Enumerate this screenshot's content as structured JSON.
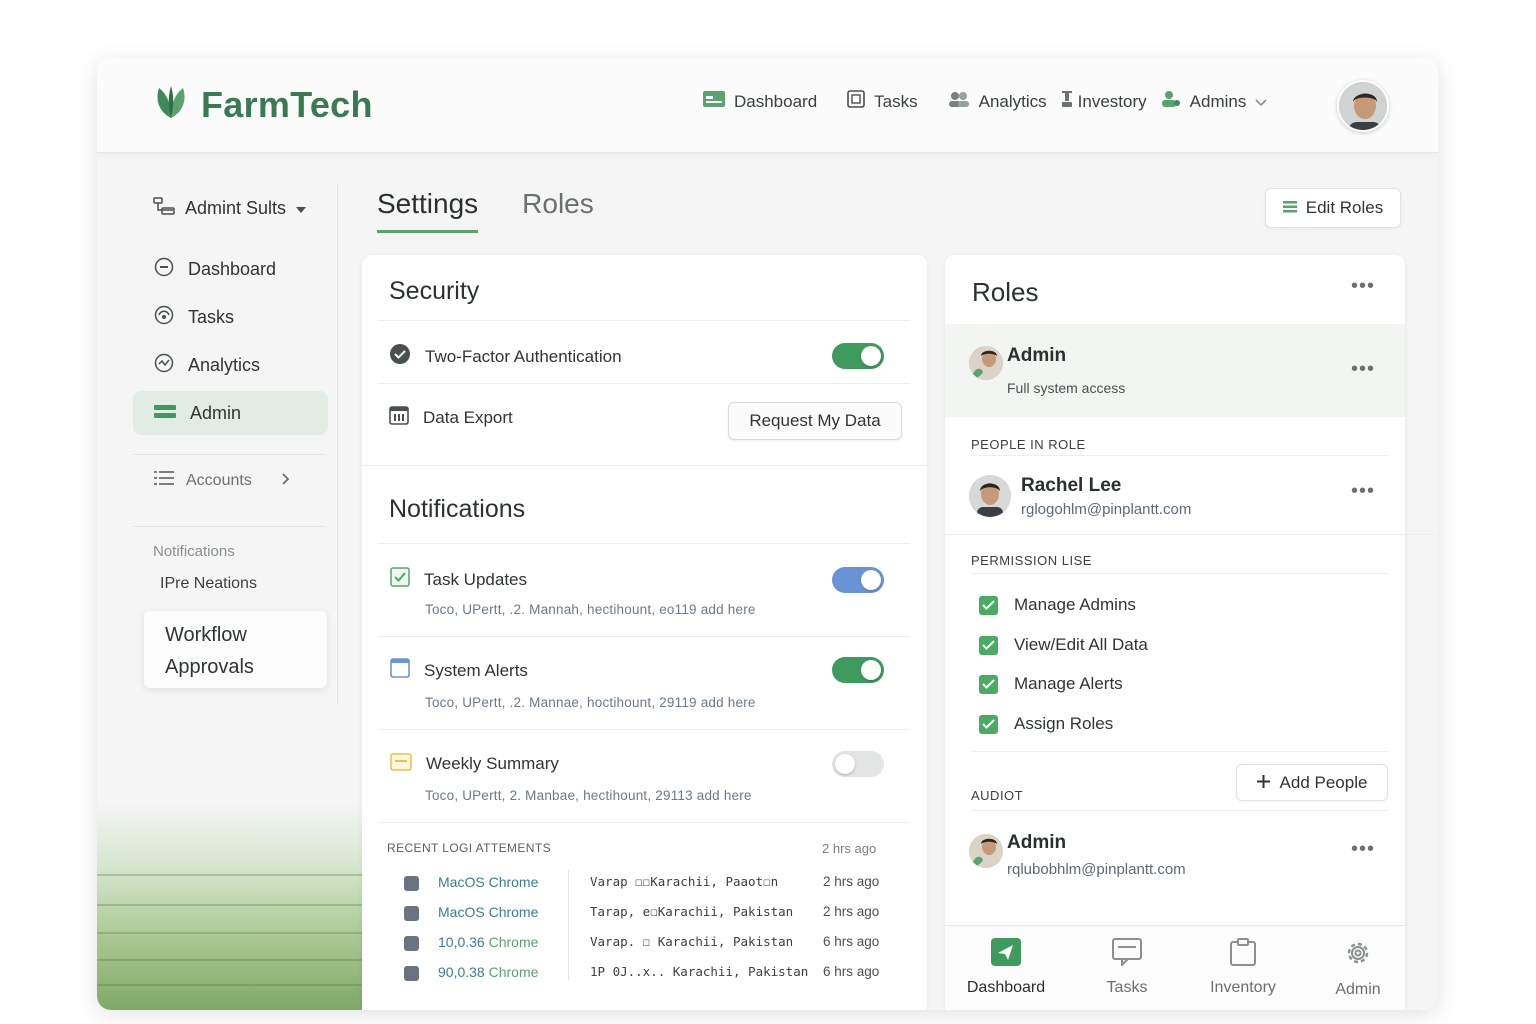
{
  "app": {
    "name": "FarmTech"
  },
  "colors": {
    "brand": "#3a7a52",
    "accent": "#5aa36e",
    "toggle_blue": "#6a93d6"
  },
  "topnav": {
    "items": [
      {
        "label": "Dashboard",
        "icon": "dashboard-icon"
      },
      {
        "label": "Tasks",
        "icon": "tasks-icon"
      },
      {
        "label": "Analytics",
        "icon": "analytics-icon"
      },
      {
        "label": "Investory",
        "icon": "inventory-icon"
      },
      {
        "label": "Admins",
        "icon": "admins-icon"
      }
    ]
  },
  "sidebar": {
    "header": "Admint Sults",
    "items": [
      {
        "label": "Dashboard"
      },
      {
        "label": "Tasks"
      },
      {
        "label": "Analytics"
      },
      {
        "label": "Admin"
      }
    ],
    "accounts": "Accounts",
    "notifications_label": "Notifications",
    "sub_item": "IPre Neations",
    "card_line1": "Workflow",
    "card_line2": "Approvals"
  },
  "tabs": [
    {
      "label": "Settings"
    },
    {
      "label": "Roles"
    }
  ],
  "edit_roles": "Edit Roles",
  "security": {
    "title": "Security",
    "two_factor": "Two-Factor Authentication",
    "data_export": "Data Export",
    "request_button": "Request My Data"
  },
  "notifications": {
    "title": "Notifications",
    "items": [
      {
        "label": "Task Updates",
        "sub": "Toco, UPertt, .2. Mannah, hectihount, eo119 add here",
        "state": "on-blue"
      },
      {
        "label": "System Alerts",
        "sub": "Toco, UPertt, .2. Mannae, hoctihount, 29119 add here",
        "state": "on-green"
      },
      {
        "label": "Weekly Summary",
        "sub": "Toco, UPertt, 2. Manbae, hectihount, 29113 add here",
        "state": "off"
      }
    ]
  },
  "logins": {
    "heading": "RECENT LOGI ATTEMENTS",
    "heading_time": "2 hrs ago",
    "rows": [
      {
        "dev_a": "MacOS",
        "dev_b": "Chrome",
        "loc": "Varap  ☐☐Karachii, Paaot☐n",
        "time": "2 hrs ago"
      },
      {
        "dev_a": "MacOS",
        "dev_b": "Chrome",
        "loc": "Tarap, e☐Karachii, Pakistan",
        "time": "2 hrs ago"
      },
      {
        "dev_a": "10,0.36",
        "dev_b": "Chrome",
        "loc": "Varap. ☐ Karachii, Pakistan",
        "time": "6 hrs ago"
      },
      {
        "dev_a": "90,0.38",
        "dev_b": "Chrome",
        "loc": "1P 0J..x.. Karachii, Pakistan",
        "time": "6 hrs ago"
      }
    ]
  },
  "roles_panel": {
    "title": "Roles",
    "admin": {
      "name": "Admin",
      "sub": "Full system access"
    },
    "people_caption": "PEOPLE IN ROLE",
    "person": {
      "name": "Rachel Lee",
      "email": "rglogohlm@pinplantt.com"
    },
    "permission_caption": "PERMISSION LISE",
    "permissions": [
      "Manage Admins",
      "View/Edit All Data",
      "Manage Alerts",
      "Assign Roles"
    ],
    "add_people": "Add People",
    "audit_caption": "AUDIOT",
    "audit_person": {
      "name": "Admin",
      "email": "rqlubobhlm@pinplantt.com"
    }
  },
  "bottom_nav": [
    {
      "label": "Dashboard",
      "icon": "send-icon",
      "active": true
    },
    {
      "label": "Tasks",
      "icon": "tasks-icon",
      "active": false
    },
    {
      "label": "Inventory",
      "icon": "clipboard-icon",
      "active": false
    },
    {
      "label": "Admin",
      "icon": "gear-icon",
      "active": false
    }
  ]
}
